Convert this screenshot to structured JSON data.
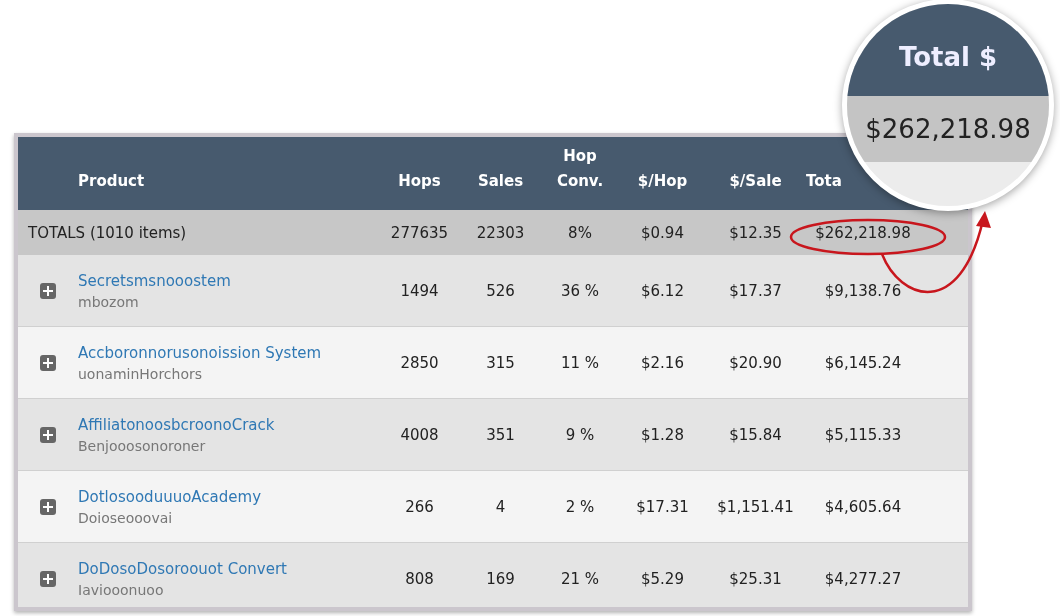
{
  "table": {
    "columns": [
      {
        "label": "Product"
      },
      {
        "label": "Hops"
      },
      {
        "label": "Sales"
      },
      {
        "label": "Hop Conv."
      },
      {
        "label": "$/Hop"
      },
      {
        "label": "$/Sale"
      },
      {
        "label": "Tota"
      }
    ],
    "totals": {
      "label": "TOTALS (1010 items)",
      "hops": "277635",
      "sales": "22303",
      "conv": "8%",
      "per_hop": "$0.94",
      "per_sale": "$12.35",
      "total": "$262,218.98",
      "highlighted": true
    },
    "rows": [
      {
        "name": "Secretsmsnooostem",
        "vendor": "mbozom",
        "hops": "1494",
        "sales": "526",
        "conv": "36 %",
        "per_hop": "$6.12",
        "per_sale": "$17.37",
        "total": "$9,138.76",
        "expanded": false
      },
      {
        "name": "Accboronnorusonoission System",
        "vendor": "uonaminHorchors",
        "hops": "2850",
        "sales": "315",
        "conv": "11 %",
        "per_hop": "$2.16",
        "per_sale": "$20.90",
        "total": "$6,145.24",
        "expanded": false
      },
      {
        "name": "AffiliatonoosbcroonoCrack",
        "vendor": "Benjooosonoroner",
        "hops": "4008",
        "sales": "351",
        "conv": "9 %",
        "per_hop": "$1.28",
        "per_sale": "$15.84",
        "total": "$5,115.33",
        "expanded": false
      },
      {
        "name": "DotlosooduuuoAcademy",
        "vendor": "Doioseooovai",
        "hops": "266",
        "sales": "4",
        "conv": "2 %",
        "per_hop": "$17.31",
        "per_sale": "$1,151.41",
        "total": "$4,605.64",
        "expanded": false
      },
      {
        "name": "DoDosoDosoroouot Convert",
        "vendor": "Iaviooonuoo",
        "hops": "808",
        "sales": "169",
        "conv": "21 %",
        "per_hop": "$5.29",
        "per_sale": "$25.31",
        "total": "$4,277.27",
        "expanded": false
      }
    ]
  },
  "magnifier": {
    "heading": "Total $",
    "value": "$262,218.98"
  }
}
